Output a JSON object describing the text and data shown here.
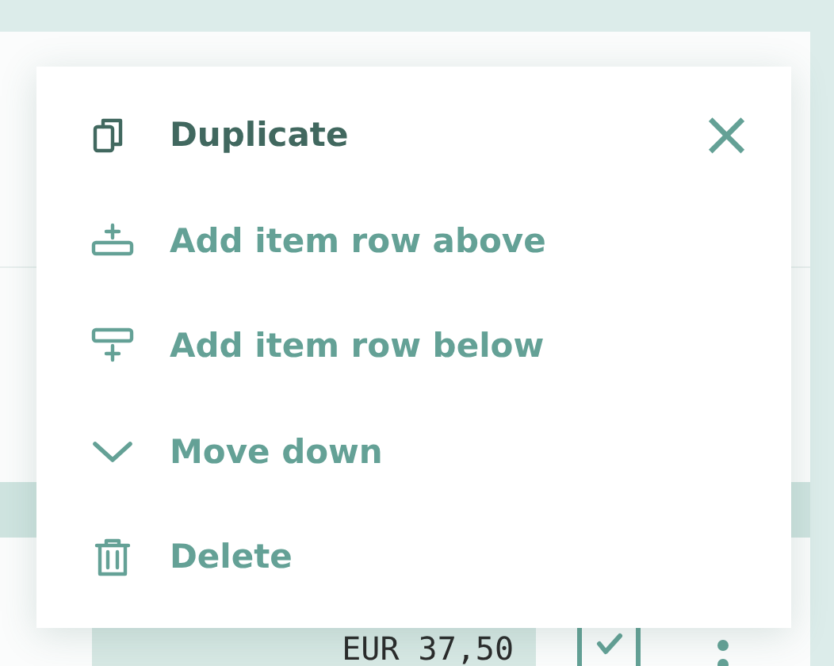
{
  "menu": {
    "close_label": "×",
    "items": [
      {
        "label": "Duplicate",
        "selected": true
      },
      {
        "label": "Add item row above",
        "selected": false
      },
      {
        "label": "Add item row below",
        "selected": false
      },
      {
        "label": "Move down",
        "selected": false
      },
      {
        "label": "Delete",
        "selected": false
      }
    ]
  },
  "row": {
    "amount": "EUR 37,50",
    "checked": true
  }
}
